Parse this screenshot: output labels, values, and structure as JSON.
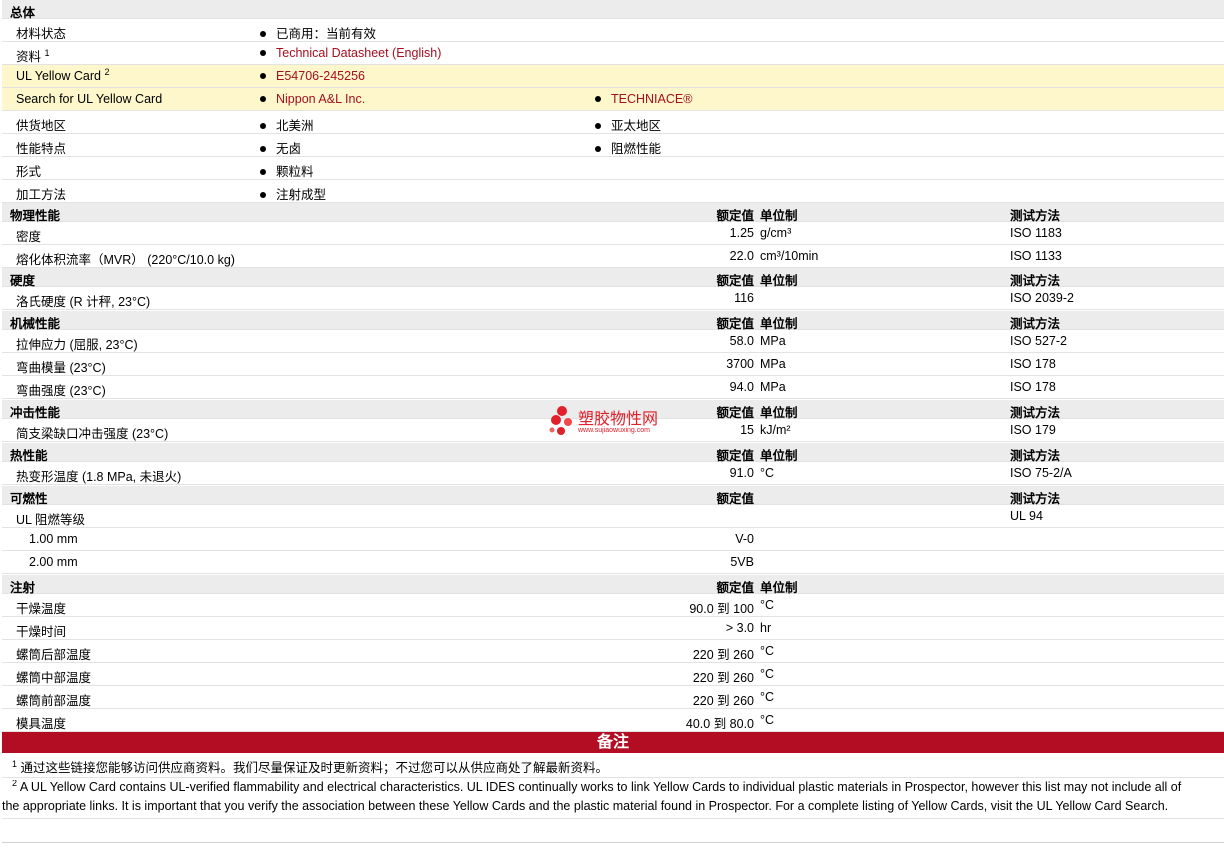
{
  "overview": {
    "header": "总体",
    "rows": [
      {
        "label": "材料状态",
        "c1": "已商用：当前有效",
        "c2": ""
      },
      {
        "label": "资料",
        "sup": "1",
        "c1": "Technical Datasheet (English)",
        "c2": ""
      },
      {
        "label": "UL Yellow Card",
        "sup": "2",
        "c1": "E54706-245256",
        "c2": ""
      },
      {
        "label": "Search for UL Yellow Card",
        "c1": "Nippon A&L Inc.",
        "c2": "TECHNIACE®"
      },
      {
        "label": "供货地区",
        "c1": "北美洲",
        "c2": "亚太地区"
      },
      {
        "label": "性能特点",
        "c1": "无卤",
        "c2": "阻燃性能"
      },
      {
        "label": "形式",
        "c1": "颗粒料",
        "c2": ""
      },
      {
        "label": "加工方法",
        "c1": "注射成型",
        "c2": ""
      }
    ]
  },
  "columns": {
    "value": "额定值",
    "unit": "单位制",
    "method": "测试方法"
  },
  "sections": {
    "physical": {
      "title": "物理性能",
      "rows": [
        {
          "label": "密度",
          "value": "1.25",
          "unit": "g/cm³",
          "method": "ISO 1183"
        },
        {
          "label": "熔化体积流率（MVR） (220°C/10.0 kg)",
          "value": "22.0",
          "unit": "cm³/10min",
          "method": "ISO 1133"
        }
      ]
    },
    "hardness": {
      "title": "硬度",
      "rows": [
        {
          "label": "洛氏硬度 (R 计秤, 23°C)",
          "value": "116",
          "unit": "",
          "method": "ISO 2039-2"
        }
      ]
    },
    "mechanical": {
      "title": "机械性能",
      "rows": [
        {
          "label": "拉伸应力 (屈服, 23°C)",
          "value": "58.0",
          "unit": "MPa",
          "method": "ISO 527-2"
        },
        {
          "label": "弯曲模量 (23°C)",
          "value": "3700",
          "unit": "MPa",
          "method": "ISO 178"
        },
        {
          "label": "弯曲强度 (23°C)",
          "value": "94.0",
          "unit": "MPa",
          "method": "ISO 178"
        }
      ]
    },
    "impact": {
      "title": "冲击性能",
      "rows": [
        {
          "label": "简支梁缺口冲击强度 (23°C)",
          "value": "15",
          "unit": "kJ/m²",
          "method": "ISO 179"
        }
      ]
    },
    "thermal": {
      "title": "热性能",
      "rows": [
        {
          "label": "热变形温度 (1.8 MPa, 未退火)",
          "value": "91.0",
          "unit": "°C",
          "method": "ISO 75-2/A"
        }
      ]
    },
    "flammability": {
      "title": "可燃性",
      "rows": [
        {
          "label": "UL 阻燃等级",
          "value": "",
          "unit": "",
          "method": "UL 94"
        },
        {
          "label": "1.00 mm",
          "value": "V-0",
          "unit": "",
          "method": ""
        },
        {
          "label": "2.00 mm",
          "value": "5VB",
          "unit": "",
          "method": ""
        }
      ]
    },
    "injection": {
      "title": "注射",
      "rows": [
        {
          "label": "干燥温度",
          "value": "90.0 到  100",
          "unit": "°C"
        },
        {
          "label": "干燥时间",
          "value": "> 3.0",
          "unit": "hr"
        },
        {
          "label": "螺筒后部温度",
          "value": "220 到  260",
          "unit": "°C"
        },
        {
          "label": "螺筒中部温度",
          "value": "220 到  260",
          "unit": "°C"
        },
        {
          "label": "螺筒前部温度",
          "value": "220 到  260",
          "unit": "°C"
        },
        {
          "label": "模具温度",
          "value": "40.0 到  80.0",
          "unit": "°C"
        }
      ]
    }
  },
  "notes": {
    "title": "备注",
    "n1_sup": "1",
    "n1": "通过这些链接您能够访问供应商资料。我们尽量保证及时更新资料；不过您可以从供应商处了解最新资料。",
    "n2_sup": "2",
    "n2a": "A UL Yellow Card contains UL-verified flammability and electrical characteristics. UL IDES continually works to link Yellow Cards to individual plastic materials in Prospector, however this list may not include all of",
    "n2b": "the appropriate links. It is important that you verify the association between these Yellow Cards and the plastic material found in Prospector. For a complete listing of Yellow Cards, visit the UL Yellow Card Search."
  },
  "watermark": {
    "text": "塑胶物性网",
    "url": "www.sujiaowuxing.com"
  },
  "colors": {
    "section_bg": "#ececec",
    "yellow_row": "#fdf7cb",
    "link": "#a50f1f",
    "notes_bar": "#b20d22"
  }
}
